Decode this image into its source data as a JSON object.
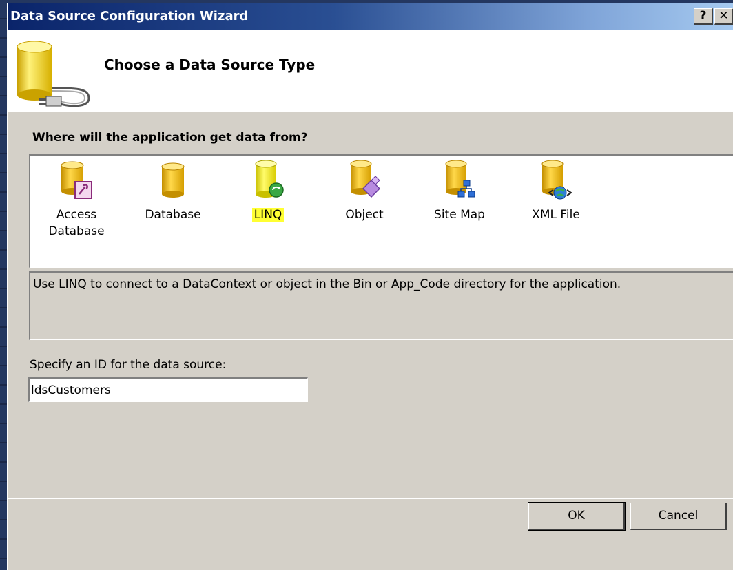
{
  "window": {
    "title": "Data Source Configuration Wizard",
    "help_label": "?",
    "close_label": "✕"
  },
  "header": {
    "title": "Choose a Data Source Type",
    "icon": "database-plug-icon"
  },
  "question": "Where will the application get data from?",
  "source_types": [
    {
      "label": "Access Database",
      "icon": "access-database-icon",
      "selected": false
    },
    {
      "label": "Database",
      "icon": "database-icon",
      "selected": false
    },
    {
      "label": "LINQ",
      "icon": "linq-icon",
      "selected": true
    },
    {
      "label": "Object",
      "icon": "object-icon",
      "selected": false
    },
    {
      "label": "Site Map",
      "icon": "site-map-icon",
      "selected": false
    },
    {
      "label": "XML File",
      "icon": "xml-file-icon",
      "selected": false
    }
  ],
  "description": "Use LINQ to connect to a DataContext or object in the Bin or App_Code directory for the application.",
  "id_field": {
    "label": "Specify an ID for the data source:",
    "value": "ldsCustomers"
  },
  "buttons": {
    "ok": "OK",
    "cancel": "Cancel"
  },
  "colors": {
    "title_gradient_start": "#0a246a",
    "title_gradient_end": "#a6caf0",
    "dialog_face": "#d4d0c8",
    "selection_highlight": "#ffff33",
    "cylinder_yellow": "#f2c81e"
  }
}
